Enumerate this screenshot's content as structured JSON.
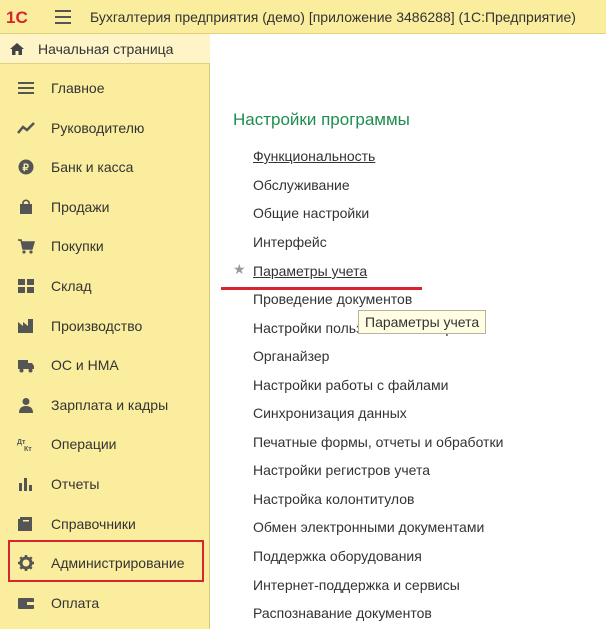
{
  "app": {
    "logo_text": "1С",
    "title": "Бухгалтерия предприятия (демо) [приложение 3486288]  (1С:Предприятие)"
  },
  "sidebar": {
    "home_label": "Начальная страница",
    "items": [
      {
        "label": "Главное",
        "icon": "list-icon"
      },
      {
        "label": "Руководителю",
        "icon": "trend-chart-icon"
      },
      {
        "label": "Банк и касса",
        "icon": "ruble-coin-icon"
      },
      {
        "label": "Продажи",
        "icon": "shopping-bag-icon"
      },
      {
        "label": "Покупки",
        "icon": "shopping-cart-icon"
      },
      {
        "label": "Склад",
        "icon": "warehouse-grid-icon"
      },
      {
        "label": "Производство",
        "icon": "factory-icon"
      },
      {
        "label": "ОС и НМА",
        "icon": "truck-icon"
      },
      {
        "label": "Зарплата и кадры",
        "icon": "person-icon"
      },
      {
        "label": "Операции",
        "icon": "debit-credit-icon"
      },
      {
        "label": "Отчеты",
        "icon": "bar-chart-icon"
      },
      {
        "label": "Справочники",
        "icon": "books-icon"
      },
      {
        "label": "Администрирование",
        "icon": "gear-icon"
      },
      {
        "label": "Оплата",
        "icon": "wallet-icon"
      }
    ]
  },
  "main": {
    "section_title": "Настройки программы",
    "links": [
      "Функциональность",
      "Обслуживание",
      "Общие настройки",
      "Интерфейс",
      "Параметры учета",
      "Проведение документов",
      "Настройки пользователей и прав",
      "Органайзер",
      "Настройки работы с файлами",
      "Синхронизация данных",
      "Печатные формы, отчеты и обработки",
      "Настройки регистров учета",
      "Настройка колонтитулов",
      "Обмен электронными документами",
      "Поддержка оборудования",
      "Интернет-поддержка и сервисы",
      "Распознавание документов"
    ],
    "tooltip": "Параметры учета"
  },
  "colors": {
    "sidebar_bg": "#fbed9e",
    "section_title": "#1e8d4f",
    "highlight": "#d8242f",
    "logo_red": "#d8242f"
  }
}
